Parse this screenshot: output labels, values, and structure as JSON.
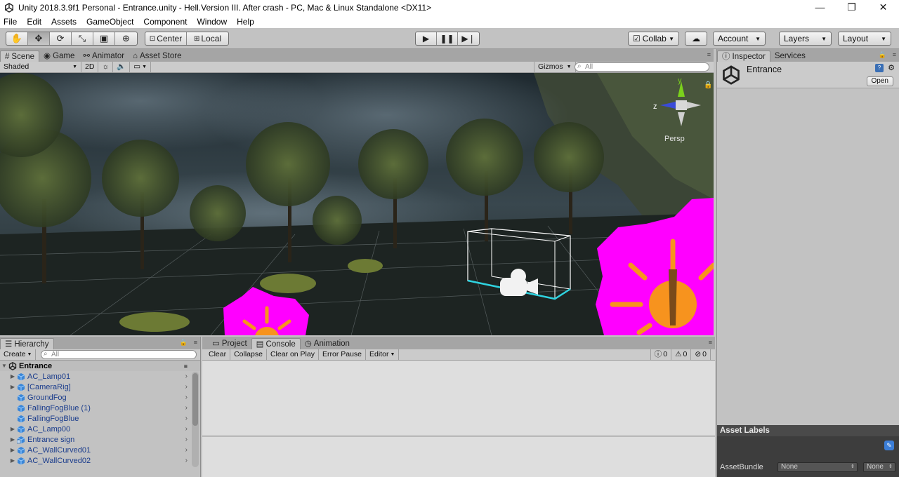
{
  "window": {
    "title": "Unity 2018.3.9f1 Personal - Entrance.unity - Hell.Version III. After crash - PC, Mac & Linux Standalone <DX11>",
    "controls": [
      "—",
      "❐",
      "✕"
    ]
  },
  "menu": [
    "File",
    "Edit",
    "Assets",
    "GameObject",
    "Component",
    "Window",
    "Help"
  ],
  "toolbar": {
    "pivot": "Center",
    "space": "Local",
    "collab": "Collab",
    "account": "Account",
    "layers": "Layers",
    "layout": "Layout"
  },
  "scene_panel": {
    "tabs": [
      "Scene",
      "Game",
      "Animator",
      "Asset Store"
    ],
    "shading": "Shaded",
    "mode_2d": "2D",
    "gizmos": "Gizmos",
    "search_placeholder": "All",
    "persp_label": "Persp",
    "axis_y": "y",
    "axis_z": "z"
  },
  "inspector": {
    "tabs": [
      "Inspector",
      "Services"
    ],
    "object_name": "Entrance",
    "open_button": "Open",
    "asset_labels": "Asset Labels",
    "asset_bundle": "AssetBundle",
    "bundle_value": "None",
    "variant_value": "None"
  },
  "hierarchy": {
    "tab": "Hierarchy",
    "create": "Create",
    "search_placeholder": "All",
    "scene_name": "Entrance",
    "items": [
      {
        "label": "AC_Lamp01",
        "expandable": true
      },
      {
        "label": "[CameraRig]",
        "expandable": true
      },
      {
        "label": "GroundFog",
        "expandable": false
      },
      {
        "label": "FallingFogBlue (1)",
        "expandable": false
      },
      {
        "label": "FallingFogBlue",
        "expandable": false
      },
      {
        "label": "AC_Lamp00",
        "expandable": true
      },
      {
        "label": "Entrance sign",
        "expandable": true
      },
      {
        "label": "AC_WallCurved01",
        "expandable": true
      },
      {
        "label": "AC_WallCurved02",
        "expandable": true
      }
    ]
  },
  "console": {
    "tabs": [
      "Project",
      "Console",
      "Animation"
    ],
    "buttons": [
      "Clear",
      "Collapse",
      "Clear on Play",
      "Error Pause",
      "Editor"
    ],
    "info_count": "0",
    "warn_count": "0",
    "error_count": "0"
  },
  "colors": {
    "panel_bg": "#c2c2c2",
    "tab_strip": "#a5a5a5",
    "hierarchy_text": "#1a3c8c",
    "magenta": "#ff00ff",
    "sun_orange": "#f7931e"
  }
}
